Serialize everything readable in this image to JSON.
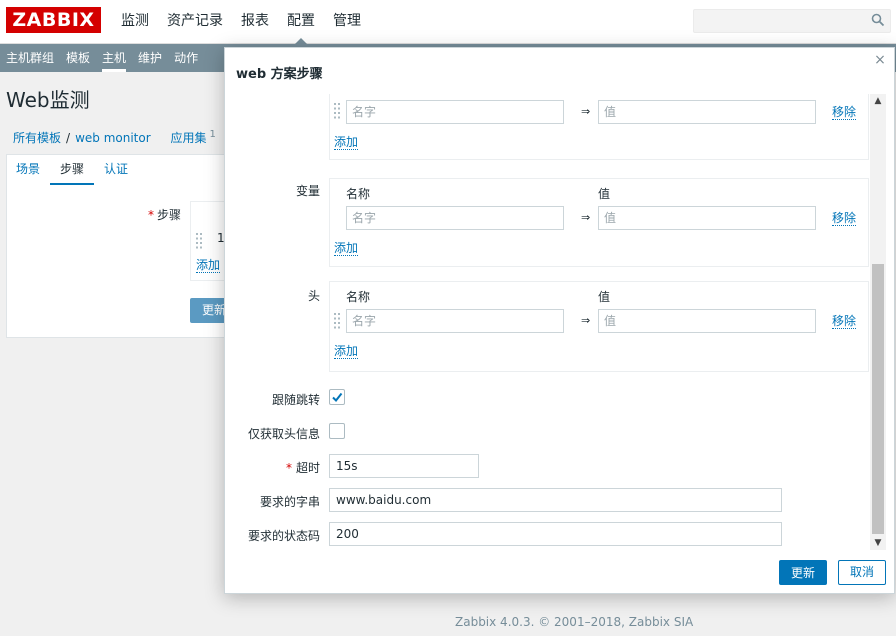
{
  "header": {
    "logo": "ZABBIX",
    "nav": [
      "监测",
      "资产记录",
      "报表",
      "配置",
      "管理"
    ],
    "active_nav": "配置"
  },
  "subnav": {
    "items": [
      "主机群组",
      "模板",
      "主机",
      "维护",
      "动作"
    ],
    "active": "主机"
  },
  "page": {
    "title": "Web监测",
    "breadcrumb": {
      "all_templates": "所有模板",
      "separator": "/",
      "template": "web monitor",
      "applications": "应用集",
      "applications_count": "1"
    },
    "tabs": [
      "场景",
      "步骤",
      "认证"
    ],
    "active_tab": "步骤",
    "steps_label": "步骤",
    "step_number": "1",
    "add_label": "添加",
    "update_label": "更新"
  },
  "footer": {
    "text": "Zabbix 4.0.3. © 2001–2018,",
    "link": "Zabbix SIA"
  },
  "modal": {
    "title": "web 方案步骤",
    "close": "×",
    "top_section": {
      "name_placeholder": "名字",
      "value_placeholder": "值",
      "remove_label": "移除",
      "add_label": "添加"
    },
    "variables": {
      "label": "变量",
      "col_name": "名称",
      "col_value": "值",
      "name_placeholder": "名字",
      "value_placeholder": "值",
      "arrow": "⇒",
      "remove_label": "移除",
      "add_label": "添加"
    },
    "headers": {
      "label": "头",
      "col_name": "名称",
      "col_value": "值",
      "name_placeholder": "名字",
      "value_placeholder": "值",
      "arrow": "⇒",
      "remove_label": "移除",
      "add_label": "添加"
    },
    "follow_redirects": {
      "label": "跟随跳转",
      "checked": true
    },
    "retrieve_headers_only": {
      "label": "仅获取头信息",
      "checked": false
    },
    "timeout": {
      "label": "超时",
      "value": "15s"
    },
    "required_string": {
      "label": "要求的字串",
      "value": "www.baidu.com"
    },
    "required_status_codes": {
      "label": "要求的状态码",
      "value": "200"
    },
    "buttons": {
      "update": "更新",
      "cancel": "取消"
    }
  },
  "colors": {
    "brand": "#d40000",
    "subnav_bg": "#768d99",
    "link": "#0275b8",
    "primary_button": "#0275b8"
  }
}
